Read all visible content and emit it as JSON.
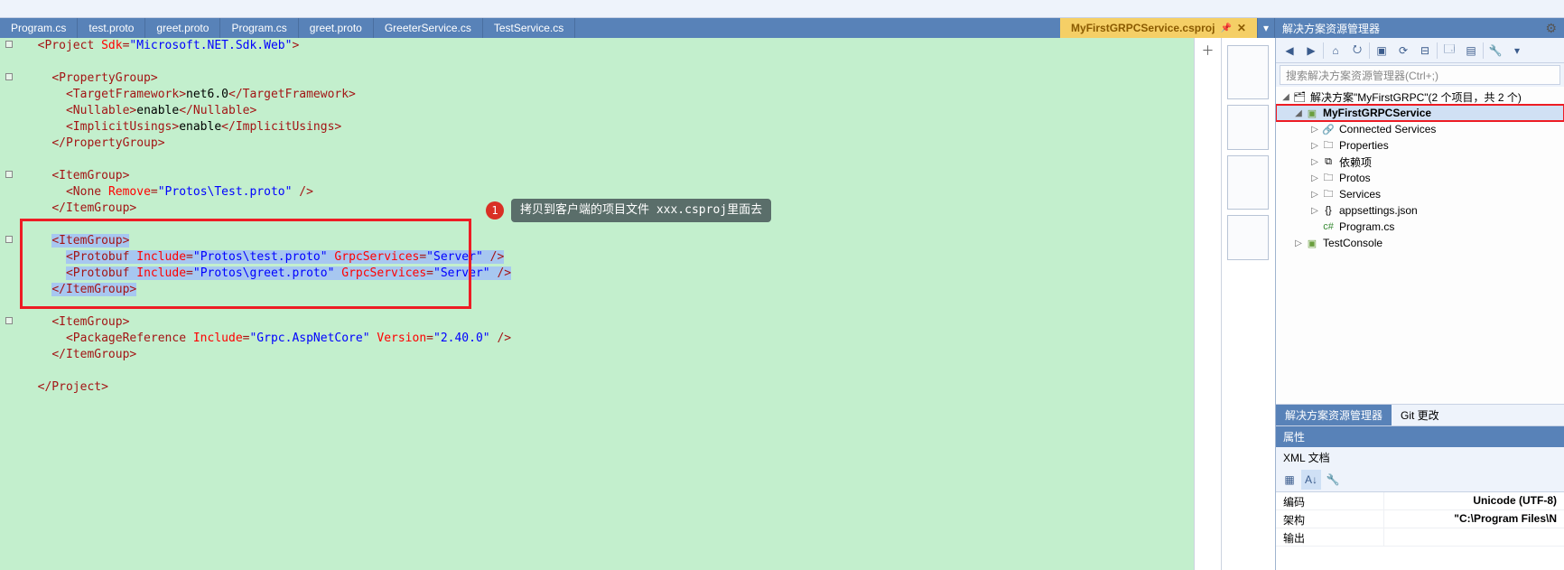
{
  "tabs": [
    {
      "label": "Program.cs"
    },
    {
      "label": "test.proto"
    },
    {
      "label": "greet.proto"
    },
    {
      "label": "Program.cs"
    },
    {
      "label": "greet.proto"
    },
    {
      "label": "GreeterService.cs"
    },
    {
      "label": "TestService.cs"
    }
  ],
  "activeTab": {
    "label": "MyFirstGRPCService.csproj"
  },
  "code": {
    "l1_pre": "<Project ",
    "l1_a": "Sdk",
    "l1_eq": "=",
    "l1_v": "\"Microsoft.NET.Sdk.Web\"",
    "l1_post": ">",
    "l3": "<PropertyGroup>",
    "l4_o": "<TargetFramework>",
    "l4_t": "net6.0",
    "l4_c": "</TargetFramework>",
    "l5_o": "<Nullable>",
    "l5_t": "enable",
    "l5_c": "</Nullable>",
    "l6_o": "<ImplicitUsings>",
    "l6_t": "enable",
    "l6_c": "</ImplicitUsings>",
    "l7": "</PropertyGroup>",
    "l9": "<ItemGroup>",
    "l10_o": "<None ",
    "l10_a": "Remove",
    "l10_v": "\"Protos\\Test.proto\"",
    "l10_c": " />",
    "l11": "</ItemGroup>",
    "l13": "<ItemGroup>",
    "l14_o": "<Protobuf ",
    "l14_a1": "Include",
    "l14_v1": "\"Protos\\test.proto\"",
    "l14_a2": "GrpcServices",
    "l14_v2": "\"Server\"",
    "l14_c": " />",
    "l15_o": "<Protobuf ",
    "l15_a1": "Include",
    "l15_v1": "\"Protos\\greet.proto\"",
    "l15_a2": "GrpcServices",
    "l15_v2": "\"Server\"",
    "l15_c": " />",
    "l16": "</ItemGroup>",
    "l18": "<ItemGroup>",
    "l19_o": "<PackageReference ",
    "l19_a1": "Include",
    "l19_v1": "\"Grpc.AspNetCore\"",
    "l19_a2": "Version",
    "l19_v2": "\"2.40.0\"",
    "l19_c": " />",
    "l20": "</ItemGroup>",
    "l22": "</Project>"
  },
  "callout": {
    "num": "1",
    "text": "拷贝到客户端的项目文件 xxx.csproj里面去"
  },
  "solutionExplorer": {
    "title": "解决方案资源管理器",
    "searchPlaceholder": "搜索解决方案资源管理器(Ctrl+;)",
    "solution": "解决方案\"MyFirstGRPC\"(2 个项目，共 2 个)",
    "project": "MyFirstGRPCService",
    "nodes": {
      "connected": "Connected Services",
      "properties": "Properties",
      "deps": "依赖项",
      "protos": "Protos",
      "services": "Services",
      "appsettings": "appsettings.json",
      "program": "Program.cs"
    },
    "project2": "TestConsole",
    "tab1": "解决方案资源管理器",
    "tab2": "Git 更改"
  },
  "properties": {
    "title": "属性",
    "doc": "XML 文档",
    "rows": {
      "encoding_name": "编码",
      "encoding_val": "Unicode (UTF-8)",
      "arch_name": "架构",
      "arch_val": "\"C:\\Program Files\\N",
      "output_name": "输出",
      "output_val": ""
    }
  }
}
